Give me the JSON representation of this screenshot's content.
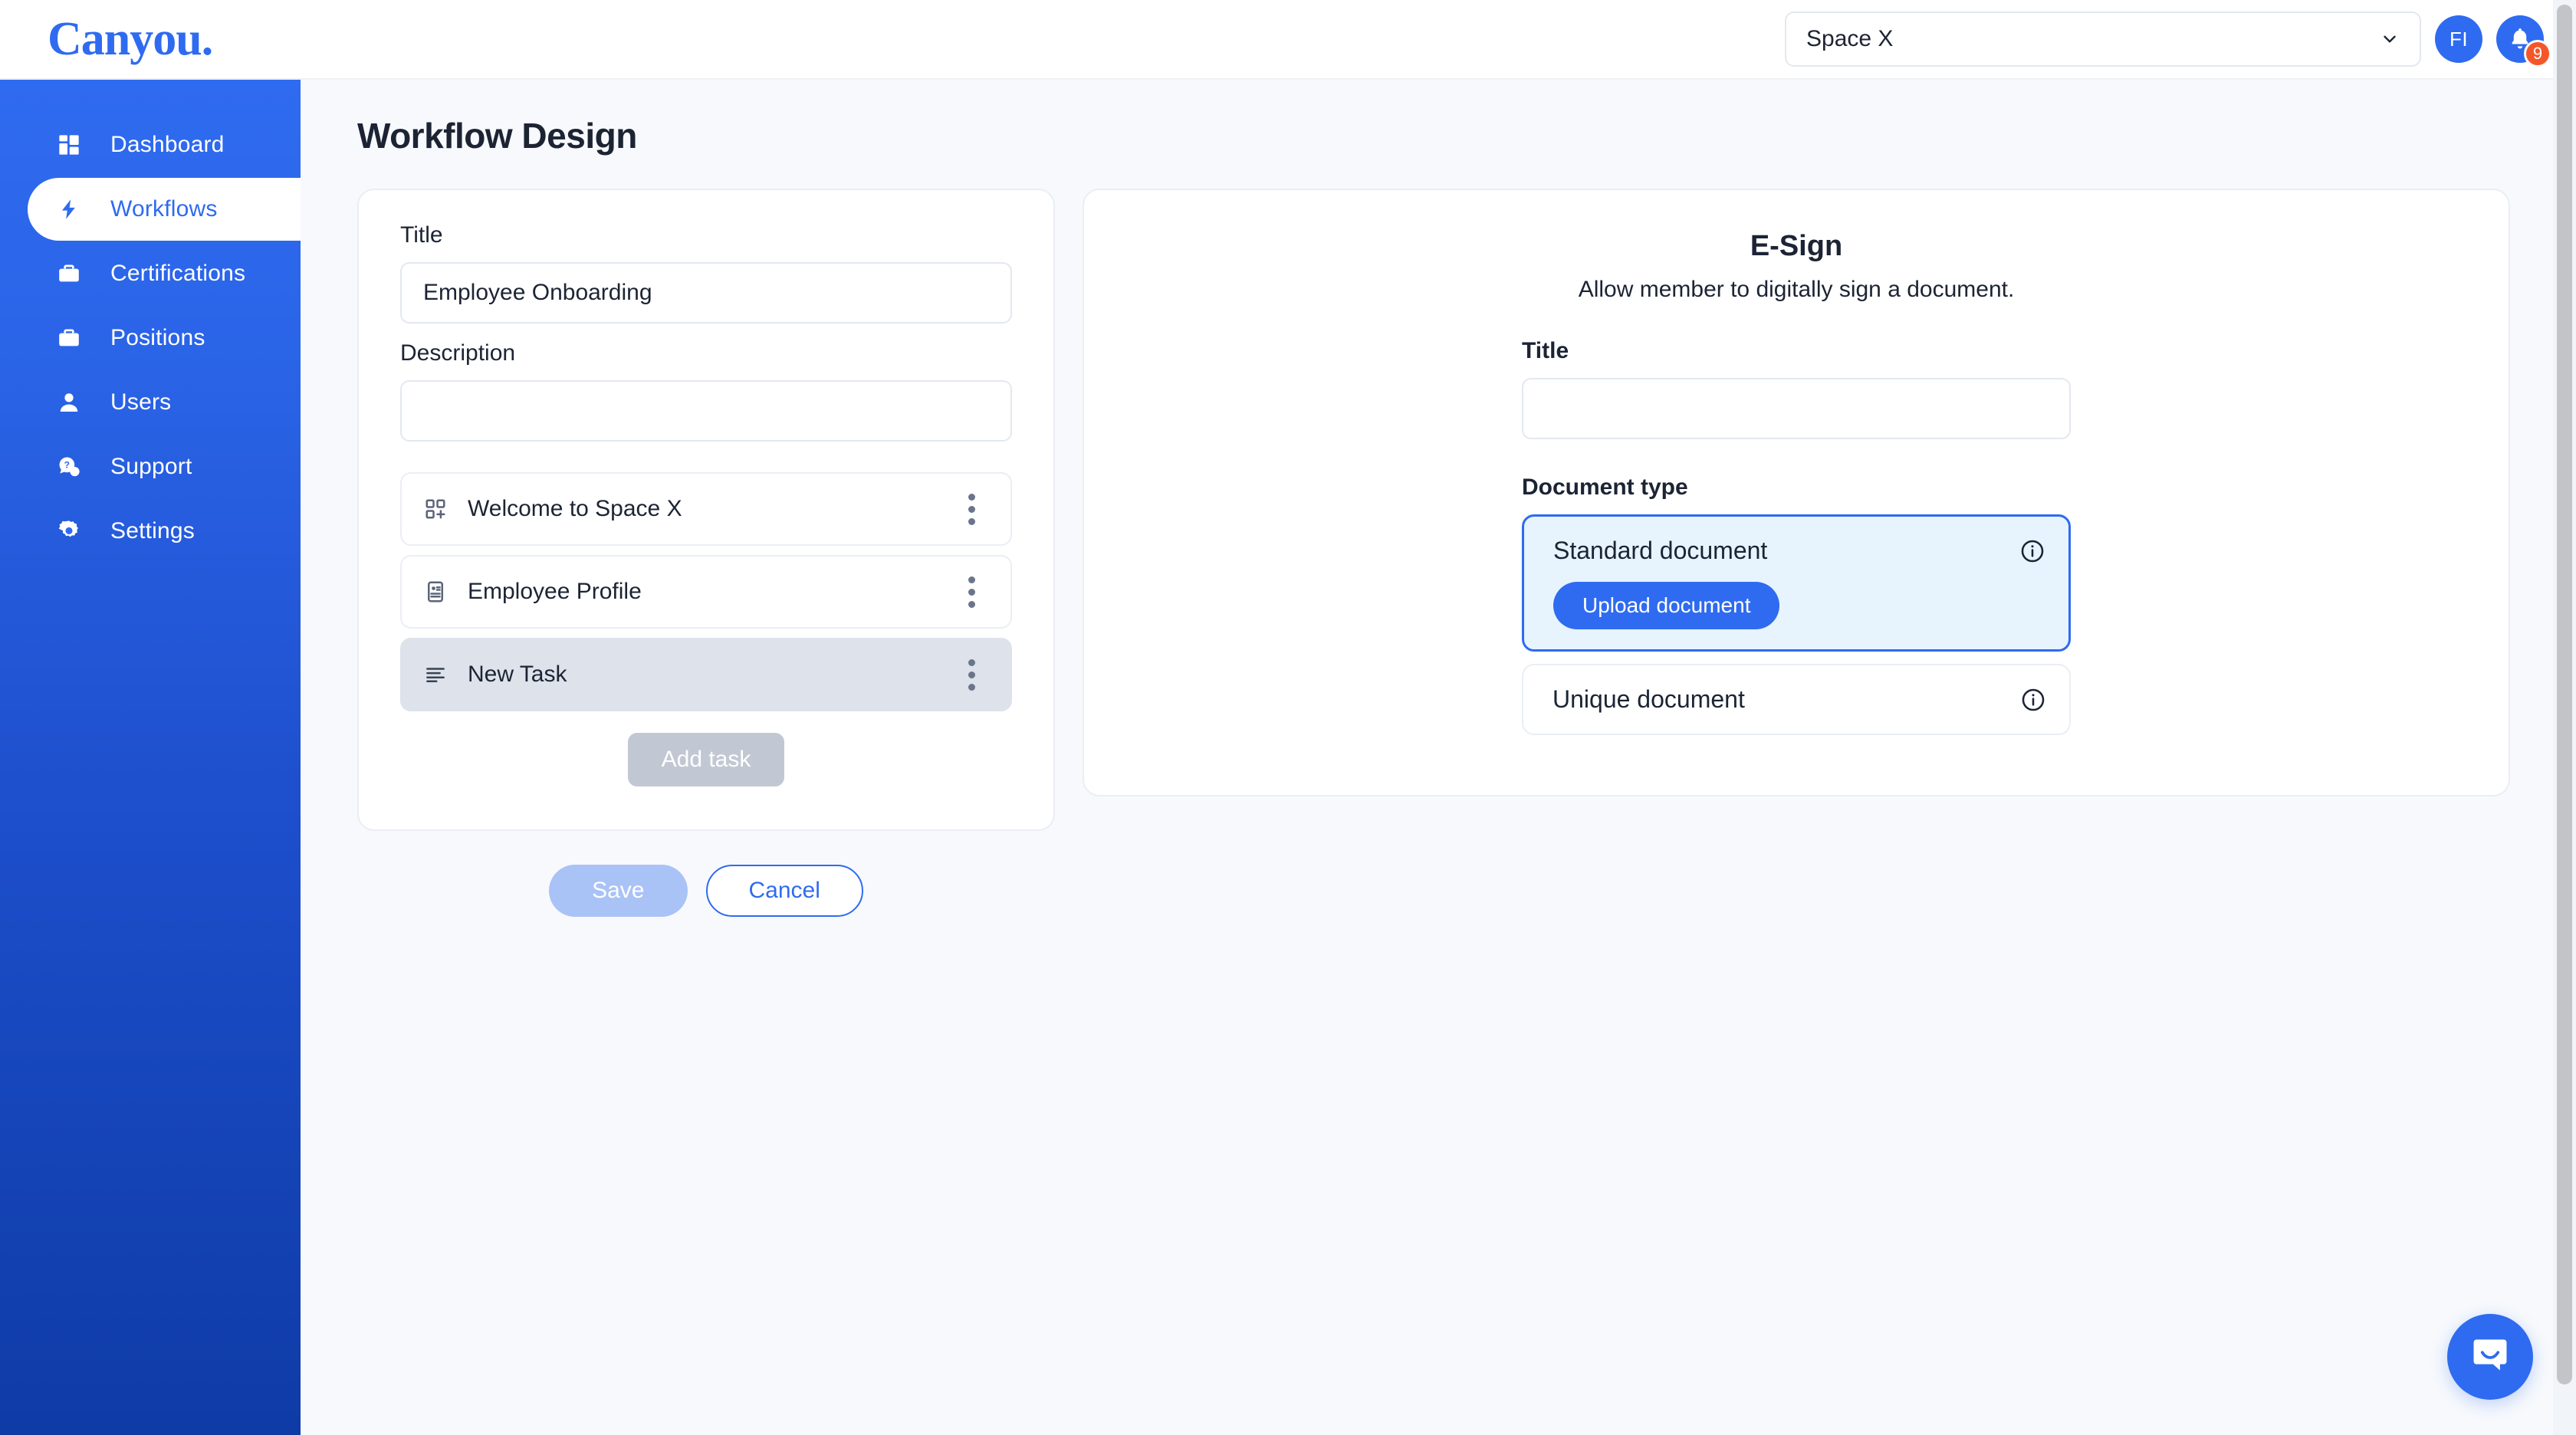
{
  "brand": {
    "logo_text": "Canyou.",
    "accent": "#2f6bf0",
    "sidebar_top": "#2f6bf0",
    "sidebar_bottom": "#0e3ba6"
  },
  "topbar": {
    "space_selector": {
      "value": "Space X",
      "icon": "chevron-down-icon"
    },
    "avatar_initials": "FI",
    "notifications": {
      "icon": "bell-icon",
      "count": "9",
      "badge_color": "#f4562a"
    }
  },
  "sidebar": {
    "items": [
      {
        "label": "Dashboard",
        "icon": "dashboard-grid-icon",
        "active": false
      },
      {
        "label": "Workflows",
        "icon": "lightning-bolt-icon",
        "active": true
      },
      {
        "label": "Certifications",
        "icon": "briefcase-icon",
        "active": false
      },
      {
        "label": "Positions",
        "icon": "briefcase-icon",
        "active": false
      },
      {
        "label": "Users",
        "icon": "user-icon",
        "active": false
      },
      {
        "label": "Support",
        "icon": "chat-question-icon",
        "active": false
      },
      {
        "label": "Settings",
        "icon": "gear-icon",
        "active": false
      }
    ]
  },
  "page": {
    "title": "Workflow Design"
  },
  "workflow_form": {
    "title_label": "Title",
    "title_value": "Employee Onboarding",
    "title_placeholder": "",
    "description_label": "Description",
    "description_value": "",
    "description_placeholder": "",
    "tasks": [
      {
        "label": "Welcome to Space X",
        "icon": "widget-grid-icon",
        "selected": false,
        "menu_icon": "kebab-menu-icon"
      },
      {
        "label": "Employee Profile",
        "icon": "id-card-icon",
        "selected": false,
        "menu_icon": "kebab-menu-icon"
      },
      {
        "label": "New Task",
        "icon": "text-lines-icon",
        "selected": true,
        "menu_icon": "kebab-menu-icon"
      }
    ],
    "add_task_label": "Add task",
    "save_label": "Save",
    "cancel_label": "Cancel"
  },
  "esign_panel": {
    "heading": "E-Sign",
    "subheading": "Allow member to digitally sign a document.",
    "title_label": "Title",
    "title_value": "",
    "title_placeholder": "",
    "document_type_label": "Document type",
    "options": [
      {
        "title": "Standard document",
        "selected": true,
        "info_icon": "info-circle-icon",
        "action_label": "Upload document"
      },
      {
        "title": "Unique document",
        "selected": false,
        "info_icon": "info-circle-icon",
        "action_label": ""
      }
    ]
  },
  "chat_widget": {
    "icon": "chat-bubble-icon"
  }
}
